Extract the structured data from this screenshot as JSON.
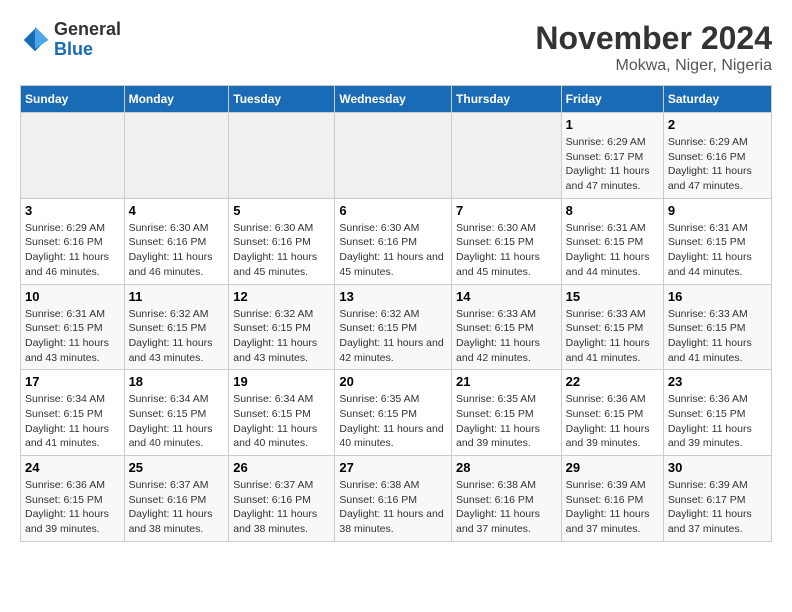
{
  "logo": {
    "general": "General",
    "blue": "Blue"
  },
  "title": "November 2024",
  "location": "Mokwa, Niger, Nigeria",
  "days_of_week": [
    "Sunday",
    "Monday",
    "Tuesday",
    "Wednesday",
    "Thursday",
    "Friday",
    "Saturday"
  ],
  "weeks": [
    [
      {
        "num": "",
        "sunrise": "",
        "sunset": "",
        "daylight": "",
        "empty": true
      },
      {
        "num": "",
        "sunrise": "",
        "sunset": "",
        "daylight": "",
        "empty": true
      },
      {
        "num": "",
        "sunrise": "",
        "sunset": "",
        "daylight": "",
        "empty": true
      },
      {
        "num": "",
        "sunrise": "",
        "sunset": "",
        "daylight": "",
        "empty": true
      },
      {
        "num": "",
        "sunrise": "",
        "sunset": "",
        "daylight": "",
        "empty": true
      },
      {
        "num": "1",
        "sunrise": "Sunrise: 6:29 AM",
        "sunset": "Sunset: 6:17 PM",
        "daylight": "Daylight: 11 hours and 47 minutes.",
        "empty": false
      },
      {
        "num": "2",
        "sunrise": "Sunrise: 6:29 AM",
        "sunset": "Sunset: 6:16 PM",
        "daylight": "Daylight: 11 hours and 47 minutes.",
        "empty": false
      }
    ],
    [
      {
        "num": "3",
        "sunrise": "Sunrise: 6:29 AM",
        "sunset": "Sunset: 6:16 PM",
        "daylight": "Daylight: 11 hours and 46 minutes.",
        "empty": false
      },
      {
        "num": "4",
        "sunrise": "Sunrise: 6:30 AM",
        "sunset": "Sunset: 6:16 PM",
        "daylight": "Daylight: 11 hours and 46 minutes.",
        "empty": false
      },
      {
        "num": "5",
        "sunrise": "Sunrise: 6:30 AM",
        "sunset": "Sunset: 6:16 PM",
        "daylight": "Daylight: 11 hours and 45 minutes.",
        "empty": false
      },
      {
        "num": "6",
        "sunrise": "Sunrise: 6:30 AM",
        "sunset": "Sunset: 6:16 PM",
        "daylight": "Daylight: 11 hours and 45 minutes.",
        "empty": false
      },
      {
        "num": "7",
        "sunrise": "Sunrise: 6:30 AM",
        "sunset": "Sunset: 6:15 PM",
        "daylight": "Daylight: 11 hours and 45 minutes.",
        "empty": false
      },
      {
        "num": "8",
        "sunrise": "Sunrise: 6:31 AM",
        "sunset": "Sunset: 6:15 PM",
        "daylight": "Daylight: 11 hours and 44 minutes.",
        "empty": false
      },
      {
        "num": "9",
        "sunrise": "Sunrise: 6:31 AM",
        "sunset": "Sunset: 6:15 PM",
        "daylight": "Daylight: 11 hours and 44 minutes.",
        "empty": false
      }
    ],
    [
      {
        "num": "10",
        "sunrise": "Sunrise: 6:31 AM",
        "sunset": "Sunset: 6:15 PM",
        "daylight": "Daylight: 11 hours and 43 minutes.",
        "empty": false
      },
      {
        "num": "11",
        "sunrise": "Sunrise: 6:32 AM",
        "sunset": "Sunset: 6:15 PM",
        "daylight": "Daylight: 11 hours and 43 minutes.",
        "empty": false
      },
      {
        "num": "12",
        "sunrise": "Sunrise: 6:32 AM",
        "sunset": "Sunset: 6:15 PM",
        "daylight": "Daylight: 11 hours and 43 minutes.",
        "empty": false
      },
      {
        "num": "13",
        "sunrise": "Sunrise: 6:32 AM",
        "sunset": "Sunset: 6:15 PM",
        "daylight": "Daylight: 11 hours and 42 minutes.",
        "empty": false
      },
      {
        "num": "14",
        "sunrise": "Sunrise: 6:33 AM",
        "sunset": "Sunset: 6:15 PM",
        "daylight": "Daylight: 11 hours and 42 minutes.",
        "empty": false
      },
      {
        "num": "15",
        "sunrise": "Sunrise: 6:33 AM",
        "sunset": "Sunset: 6:15 PM",
        "daylight": "Daylight: 11 hours and 41 minutes.",
        "empty": false
      },
      {
        "num": "16",
        "sunrise": "Sunrise: 6:33 AM",
        "sunset": "Sunset: 6:15 PM",
        "daylight": "Daylight: 11 hours and 41 minutes.",
        "empty": false
      }
    ],
    [
      {
        "num": "17",
        "sunrise": "Sunrise: 6:34 AM",
        "sunset": "Sunset: 6:15 PM",
        "daylight": "Daylight: 11 hours and 41 minutes.",
        "empty": false
      },
      {
        "num": "18",
        "sunrise": "Sunrise: 6:34 AM",
        "sunset": "Sunset: 6:15 PM",
        "daylight": "Daylight: 11 hours and 40 minutes.",
        "empty": false
      },
      {
        "num": "19",
        "sunrise": "Sunrise: 6:34 AM",
        "sunset": "Sunset: 6:15 PM",
        "daylight": "Daylight: 11 hours and 40 minutes.",
        "empty": false
      },
      {
        "num": "20",
        "sunrise": "Sunrise: 6:35 AM",
        "sunset": "Sunset: 6:15 PM",
        "daylight": "Daylight: 11 hours and 40 minutes.",
        "empty": false
      },
      {
        "num": "21",
        "sunrise": "Sunrise: 6:35 AM",
        "sunset": "Sunset: 6:15 PM",
        "daylight": "Daylight: 11 hours and 39 minutes.",
        "empty": false
      },
      {
        "num": "22",
        "sunrise": "Sunrise: 6:36 AM",
        "sunset": "Sunset: 6:15 PM",
        "daylight": "Daylight: 11 hours and 39 minutes.",
        "empty": false
      },
      {
        "num": "23",
        "sunrise": "Sunrise: 6:36 AM",
        "sunset": "Sunset: 6:15 PM",
        "daylight": "Daylight: 11 hours and 39 minutes.",
        "empty": false
      }
    ],
    [
      {
        "num": "24",
        "sunrise": "Sunrise: 6:36 AM",
        "sunset": "Sunset: 6:15 PM",
        "daylight": "Daylight: 11 hours and 39 minutes.",
        "empty": false
      },
      {
        "num": "25",
        "sunrise": "Sunrise: 6:37 AM",
        "sunset": "Sunset: 6:16 PM",
        "daylight": "Daylight: 11 hours and 38 minutes.",
        "empty": false
      },
      {
        "num": "26",
        "sunrise": "Sunrise: 6:37 AM",
        "sunset": "Sunset: 6:16 PM",
        "daylight": "Daylight: 11 hours and 38 minutes.",
        "empty": false
      },
      {
        "num": "27",
        "sunrise": "Sunrise: 6:38 AM",
        "sunset": "Sunset: 6:16 PM",
        "daylight": "Daylight: 11 hours and 38 minutes.",
        "empty": false
      },
      {
        "num": "28",
        "sunrise": "Sunrise: 6:38 AM",
        "sunset": "Sunset: 6:16 PM",
        "daylight": "Daylight: 11 hours and 37 minutes.",
        "empty": false
      },
      {
        "num": "29",
        "sunrise": "Sunrise: 6:39 AM",
        "sunset": "Sunset: 6:16 PM",
        "daylight": "Daylight: 11 hours and 37 minutes.",
        "empty": false
      },
      {
        "num": "30",
        "sunrise": "Sunrise: 6:39 AM",
        "sunset": "Sunset: 6:17 PM",
        "daylight": "Daylight: 11 hours and 37 minutes.",
        "empty": false
      }
    ]
  ]
}
